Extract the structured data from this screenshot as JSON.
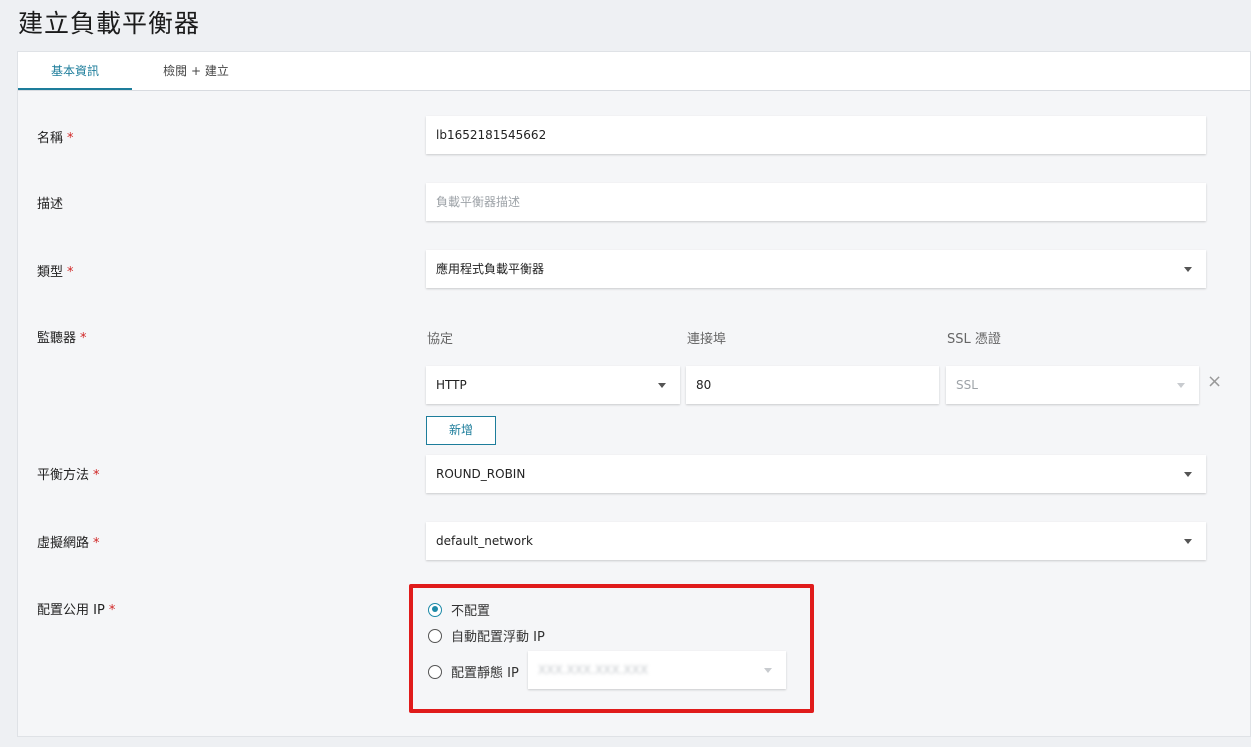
{
  "page": {
    "title": "建立負載平衡器"
  },
  "tabs": [
    {
      "label": "基本資訊",
      "active": true
    },
    {
      "label": "檢閱 + 建立",
      "active": false
    }
  ],
  "form": {
    "name": {
      "label": "名稱",
      "required_mark": "*",
      "value": "lb1652181545662"
    },
    "description": {
      "label": "描述",
      "placeholder": "負載平衡器描述",
      "value": ""
    },
    "type": {
      "label": "類型",
      "required_mark": "*",
      "value": "應用程式負載平衡器"
    },
    "listener": {
      "label": "監聽器",
      "required_mark": "*",
      "protocol_header": "協定",
      "port_header": "連接埠",
      "ssl_header": "SSL 憑證",
      "protocol_value": "HTTP",
      "port_value": "80",
      "ssl_placeholder": "SSL",
      "add_label": "新增"
    },
    "balance_method": {
      "label": "平衡方法",
      "required_mark": "*",
      "value": "ROUND_ROBIN"
    },
    "virtual_network": {
      "label": "虛擬網路",
      "required_mark": "*",
      "value": "default_network"
    },
    "public_ip": {
      "label": "配置公用 IP",
      "required_mark": "*",
      "options": [
        {
          "label": "不配置",
          "checked": true
        },
        {
          "label": "自動配置浮動 IP",
          "checked": false
        },
        {
          "label": "配置靜態 IP",
          "checked": false
        }
      ],
      "static_ip_value": "XXX.XXX.XXX.XXX"
    }
  },
  "colors": {
    "accent": "#1d7d9b",
    "highlight": "#e01b1b",
    "required": "#d02525"
  },
  "icons": {
    "dropdown": "chevron-down-icon",
    "remove": "close-icon"
  }
}
